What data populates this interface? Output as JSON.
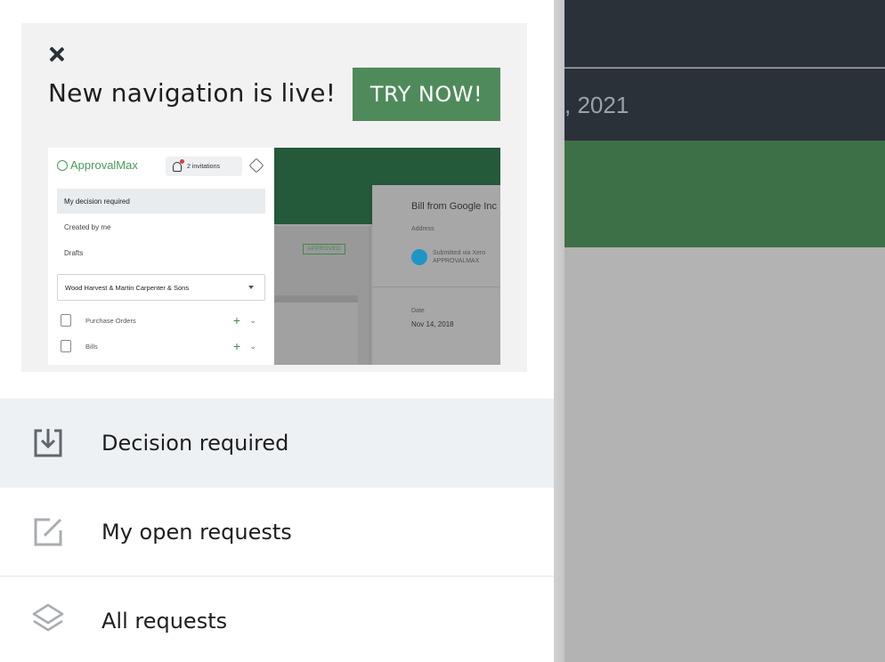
{
  "background": {
    "date_fragment": ", 2021"
  },
  "promo": {
    "title": "New navigation is live!",
    "cta_label": "TRY NOW!",
    "close_icon": "close-icon",
    "preview": {
      "logo": "ApprovalMax",
      "invitations": "2 invitations",
      "items": [
        "My decision required",
        "Created by me",
        "Drafts"
      ],
      "org_select": "Wood Harvest & Martin Carpenter & Sons",
      "sections": [
        "Purchase Orders",
        "Bills"
      ],
      "status_badge": "APPROVED",
      "card_title": "Bill from Google Inc",
      "card_address_label": "Address",
      "card_submitted": "Submitted via Xero",
      "card_submitted_org": "APPROVALMAX",
      "card_date_label": "Date",
      "card_date_value": "Nov 14, 2018"
    }
  },
  "nav": {
    "items": [
      {
        "label": "Decision required",
        "icon": "inbox-download-icon",
        "active": true
      },
      {
        "label": "My open requests",
        "icon": "edit-square-icon",
        "active": false
      },
      {
        "label": "All requests",
        "icon": "layers-icon",
        "active": false
      }
    ]
  },
  "colors": {
    "accent_green": "#4f8a5b",
    "dark_header": "#2a3139",
    "active_row": "#edf1f4"
  }
}
